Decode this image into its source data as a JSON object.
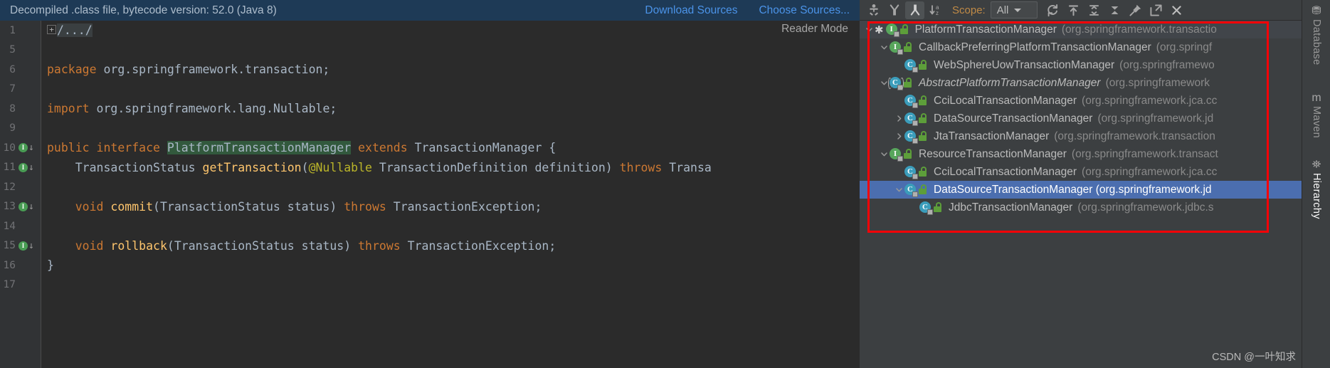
{
  "notification": {
    "message": "Decompiled .class file, bytecode version: 52.0 (Java 8)",
    "download_sources": "Download Sources",
    "choose_sources": "Choose Sources..."
  },
  "editor": {
    "reader_mode": "Reader Mode",
    "lines": [
      {
        "num": "1",
        "gutter": "",
        "fold": "+",
        "segments": [
          {
            "t": "/.../",
            "c": "folded"
          }
        ]
      },
      {
        "num": "5",
        "gutter": "",
        "fold": "",
        "segments": []
      },
      {
        "num": "6",
        "gutter": "",
        "fold": "",
        "segments": [
          {
            "t": "package ",
            "c": "tok-kw"
          },
          {
            "t": "org.springframework.transaction;",
            "c": "tok-txt"
          }
        ]
      },
      {
        "num": "7",
        "gutter": "",
        "fold": "",
        "segments": []
      },
      {
        "num": "8",
        "gutter": "",
        "fold": "",
        "segments": [
          {
            "t": "import ",
            "c": "tok-kw"
          },
          {
            "t": "org.springframework.lang.",
            "c": "tok-txt"
          },
          {
            "t": "Nullable",
            "c": "tok-txt"
          },
          {
            "t": ";",
            "c": "tok-txt"
          }
        ]
      },
      {
        "num": "9",
        "gutter": "",
        "fold": "",
        "segments": []
      },
      {
        "num": "10",
        "gutter": "impl",
        "fold": "",
        "segments": [
          {
            "t": "public interface ",
            "c": "tok-kw"
          },
          {
            "t": "PlatformTransactionManager",
            "c": "tok-cls-hl"
          },
          {
            "t": " ",
            "c": "tok-txt"
          },
          {
            "t": "extends ",
            "c": "tok-kw"
          },
          {
            "t": "TransactionManager {",
            "c": "tok-txt"
          }
        ]
      },
      {
        "num": "11",
        "gutter": "impl",
        "fold": "",
        "segments": [
          {
            "t": "    TransactionStatus ",
            "c": "tok-txt"
          },
          {
            "t": "getTransaction",
            "c": "tok-meth"
          },
          {
            "t": "(",
            "c": "tok-txt"
          },
          {
            "t": "@Nullable",
            "c": "tok-ann"
          },
          {
            "t": " TransactionDefinition definition) ",
            "c": "tok-txt"
          },
          {
            "t": "throws ",
            "c": "tok-kw"
          },
          {
            "t": "Transa",
            "c": "tok-txt"
          }
        ]
      },
      {
        "num": "12",
        "gutter": "",
        "fold": "",
        "segments": []
      },
      {
        "num": "13",
        "gutter": "impl",
        "fold": "",
        "segments": [
          {
            "t": "    void ",
            "c": "tok-kw"
          },
          {
            "t": "commit",
            "c": "tok-meth"
          },
          {
            "t": "(TransactionStatus status) ",
            "c": "tok-txt"
          },
          {
            "t": "throws ",
            "c": "tok-kw"
          },
          {
            "t": "TransactionException;",
            "c": "tok-txt"
          }
        ]
      },
      {
        "num": "14",
        "gutter": "",
        "fold": "",
        "segments": []
      },
      {
        "num": "15",
        "gutter": "impl",
        "fold": "",
        "segments": [
          {
            "t": "    void ",
            "c": "tok-kw"
          },
          {
            "t": "rollback",
            "c": "tok-meth"
          },
          {
            "t": "(TransactionStatus status) ",
            "c": "tok-txt"
          },
          {
            "t": "throws ",
            "c": "tok-kw"
          },
          {
            "t": "TransactionException;",
            "c": "tok-txt"
          }
        ]
      },
      {
        "num": "16",
        "gutter": "",
        "fold": "",
        "segments": [
          {
            "t": "}",
            "c": "tok-txt"
          }
        ]
      },
      {
        "num": "17",
        "gutter": "",
        "fold": "",
        "segments": []
      }
    ]
  },
  "hierarchy": {
    "toolbar": {
      "type_hierarchy": "type-hierarchy-icon",
      "supertypes": "supertypes-hierarchy-icon",
      "subtypes": "subtypes-hierarchy-icon",
      "sort_alpha": "sort-alphabetically-icon",
      "scope_label": "Scope:",
      "scope_value": "All",
      "refresh": "refresh-icon",
      "expand_all": "expand-all-icon",
      "collapse_all": "collapse-all-icon",
      "collapse": "collapse-icon",
      "pin": "pin-tab-icon",
      "open_in_window": "open-in-new-window-icon",
      "close": "close-icon"
    },
    "rows": [
      {
        "indent": 0,
        "twist": "down",
        "star": true,
        "kind": "iface",
        "badge": "I",
        "name": "PlatformTransactionManager",
        "pkg": "(org.springframework.transactio",
        "selected": false,
        "focused": true
      },
      {
        "indent": 1,
        "twist": "down",
        "star": false,
        "kind": "iface",
        "badge": "I",
        "name": "CallbackPreferringPlatformTransactionManager",
        "pkg": "(org.springf",
        "selected": false,
        "focused": false
      },
      {
        "indent": 2,
        "twist": "none",
        "star": false,
        "kind": "cls",
        "badge": "C",
        "name": "WebSphereUowTransactionManager",
        "pkg": "(org.springframewo",
        "selected": false,
        "focused": false
      },
      {
        "indent": 1,
        "twist": "down",
        "star": false,
        "kind": "abs",
        "badge": "C",
        "name": "AbstractPlatformTransactionManager",
        "pkg": "(org.springframework",
        "selected": false,
        "focused": false
      },
      {
        "indent": 2,
        "twist": "none",
        "star": false,
        "kind": "cls",
        "badge": "C",
        "name": "CciLocalTransactionManager",
        "pkg": "(org.springframework.jca.cc",
        "selected": false,
        "focused": false
      },
      {
        "indent": 2,
        "twist": "right",
        "star": false,
        "kind": "cls",
        "badge": "C",
        "name": "DataSourceTransactionManager",
        "pkg": "(org.springframework.jd",
        "selected": false,
        "focused": false
      },
      {
        "indent": 2,
        "twist": "right",
        "star": false,
        "kind": "cls",
        "badge": "C",
        "name": "JtaTransactionManager",
        "pkg": "(org.springframework.transaction",
        "selected": false,
        "focused": false
      },
      {
        "indent": 1,
        "twist": "down",
        "star": false,
        "kind": "iface",
        "badge": "I",
        "name": "ResourceTransactionManager",
        "pkg": "(org.springframework.transact",
        "selected": false,
        "focused": false
      },
      {
        "indent": 2,
        "twist": "none",
        "star": false,
        "kind": "cls",
        "badge": "C",
        "name": "CciLocalTransactionManager",
        "pkg": "(org.springframework.jca.cc",
        "selected": false,
        "focused": false
      },
      {
        "indent": 2,
        "twist": "down",
        "star": false,
        "kind": "cls",
        "badge": "C",
        "name": "DataSourceTransactionManager (org.springframework.jd",
        "pkg": "",
        "selected": true,
        "focused": false
      },
      {
        "indent": 3,
        "twist": "none",
        "star": false,
        "kind": "cls",
        "badge": "C",
        "name": "JdbcTransactionManager",
        "pkg": "(org.springframework.jdbc.s",
        "selected": false,
        "focused": false
      }
    ]
  },
  "right_rail": [
    {
      "label": "Database",
      "active": false
    },
    {
      "label": "Maven",
      "active": false
    },
    {
      "label": "Hierarchy",
      "active": true
    }
  ],
  "watermark": "CSDN @一叶知求",
  "colors": {
    "accent_link": "#4b93e8",
    "notification_bg": "#1e3a56",
    "selection_blue": "#4b6eaf",
    "annotation_red": "#fb0007",
    "interface_green": "#58a65c",
    "class_blue": "#3b9dbb"
  }
}
